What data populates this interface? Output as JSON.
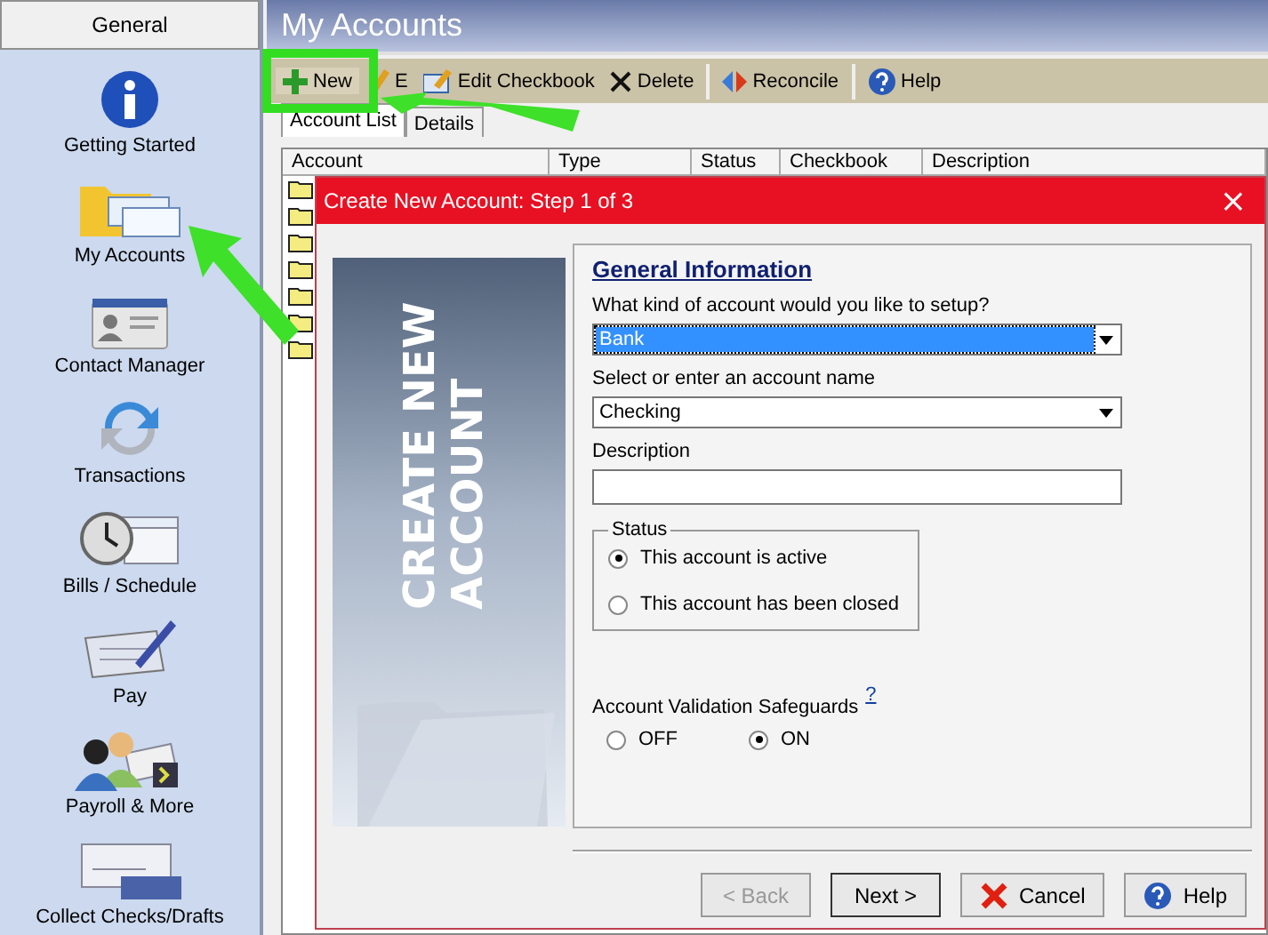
{
  "sidebar": {
    "header": "General",
    "items": [
      {
        "label": "Getting Started",
        "kind": "info"
      },
      {
        "label": "My Accounts",
        "kind": "accounts"
      },
      {
        "label": "Contact Manager",
        "kind": "contact"
      },
      {
        "label": "Transactions",
        "kind": "transactions"
      },
      {
        "label": "Bills / Schedule",
        "kind": "bills"
      },
      {
        "label": "Pay",
        "kind": "pay"
      },
      {
        "label": "Payroll & More",
        "kind": "payroll"
      },
      {
        "label": "Collect Checks/Drafts",
        "kind": "draft"
      }
    ]
  },
  "page": {
    "title": "My Accounts"
  },
  "toolbar": [
    {
      "label": "New",
      "kind": "new"
    },
    {
      "label": "E",
      "kind": "edit"
    },
    {
      "label": "Edit Checkbook",
      "kind": "checkbook"
    },
    {
      "label": "Delete",
      "kind": "delete"
    },
    {
      "label": "Reconcile",
      "kind": "reconcile"
    },
    {
      "label": "Help",
      "kind": "help"
    }
  ],
  "tabs": [
    {
      "label": "Account List",
      "selected": true
    },
    {
      "label": "Details",
      "selected": false
    }
  ],
  "table": {
    "columns": [
      "Account",
      "Type",
      "Status",
      "Checkbook",
      "Description"
    ]
  },
  "dialog": {
    "title": "Create New Account: Step 1 of 3",
    "close": "×",
    "banner": [
      "CREATE NEW",
      "ACCOUNT"
    ],
    "heading": "General Information",
    "kind_label": "What kind of account would you like to setup?",
    "kind_value": "Bank",
    "name_label": "Select or enter an account name",
    "name_value": "Checking",
    "description_label": "Description",
    "status": {
      "legend": "Status",
      "options": [
        {
          "label": "This account is active",
          "selected": true
        },
        {
          "label": "This account has been closed",
          "selected": false
        }
      ]
    },
    "safeguards": {
      "label": "Account Validation Safeguards",
      "help": "?",
      "options": [
        {
          "label": "OFF",
          "selected": false
        },
        {
          "label": "ON",
          "selected": true
        }
      ]
    },
    "buttons": [
      {
        "label": "< Back",
        "kind": "back",
        "disabled": true
      },
      {
        "label": "Next >",
        "kind": "next",
        "disabled": false
      },
      {
        "label": "Cancel",
        "kind": "cancel",
        "disabled": false
      },
      {
        "label": "Help",
        "kind": "help",
        "disabled": false
      }
    ]
  }
}
